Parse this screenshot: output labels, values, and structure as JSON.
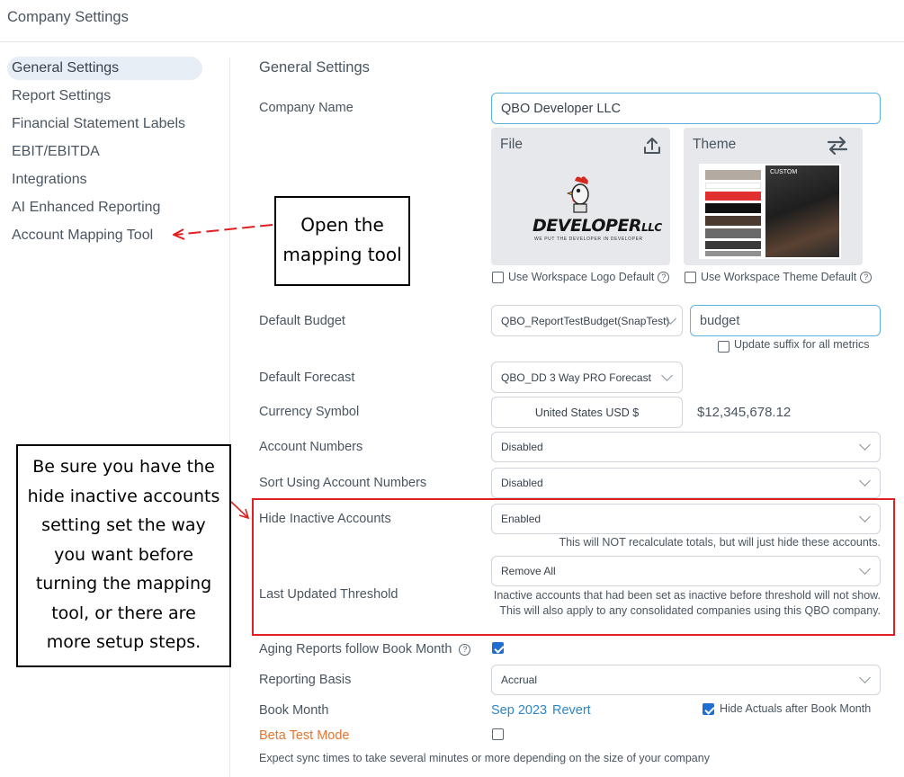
{
  "page_title": "Company Settings",
  "sidebar": {
    "items": [
      {
        "label": "General Settings",
        "active": true
      },
      {
        "label": "Report Settings"
      },
      {
        "label": "Financial Statement Labels"
      },
      {
        "label": "EBIT/EBITDA"
      },
      {
        "label": "Integrations"
      },
      {
        "label": "AI Enhanced Reporting"
      },
      {
        "label": "Account Mapping Tool"
      }
    ]
  },
  "section_title": "General Settings",
  "company_name": {
    "label": "Company Name",
    "value": "QBO Developer LLC"
  },
  "file_card": {
    "title": "File",
    "logo_text": "DEVELOPER",
    "logo_suffix": "LLC",
    "logo_tagline": "WE PUT THE DEVELOPER IN DEVELOPER",
    "checkbox_label": "Use Workspace Logo Default"
  },
  "theme_card": {
    "title": "Theme",
    "badge": "CUSTOM",
    "checkbox_label": "Use Workspace Theme Default",
    "swatches": [
      "#b3aaa2",
      "#ffffff",
      "#e03030",
      "#111111",
      "#4a3a30",
      "#6a6a6a",
      "#3a3a3a",
      "#909090"
    ]
  },
  "default_budget": {
    "label": "Default Budget",
    "value": "QBO_ReportTestBudget(SnapTest)",
    "suffix_value": "budget",
    "suffix_checkbox_label": "Update suffix for all metrics"
  },
  "default_forecast": {
    "label": "Default Forecast",
    "value": "QBO_DD 3 Way PRO Forecast"
  },
  "currency": {
    "label": "Currency Symbol",
    "value": "United States USD $",
    "example": "$12,345,678.12"
  },
  "account_numbers": {
    "label": "Account Numbers",
    "value": "Disabled"
  },
  "sort_account_numbers": {
    "label": "Sort Using Account Numbers",
    "value": "Disabled"
  },
  "hide_inactive": {
    "label": "Hide Inactive Accounts",
    "value": "Enabled",
    "note": "This will NOT recalculate totals, but will just hide these accounts."
  },
  "last_updated": {
    "label": "Last Updated Threshold",
    "value": "Remove All",
    "note": "Inactive accounts that had been set as inactive before threshold will not show. This will also apply to any consolidated companies using this QBO company."
  },
  "aging_reports": {
    "label": "Aging Reports follow Book Month",
    "checked": true
  },
  "reporting_basis": {
    "label": "Reporting Basis",
    "value": "Accrual"
  },
  "book_month": {
    "label": "Book Month",
    "value": "Sep 2023",
    "revert_label": "Revert",
    "hide_actuals_label": "Hide Actuals after Book Month",
    "hide_actuals_checked": true
  },
  "beta_test": {
    "label": "Beta Test Mode",
    "checked": false,
    "note": "Expect sync times to take several minutes or more depending on the size of your company"
  },
  "annotations": {
    "mapping_callout": [
      "Open the",
      "mapping tool"
    ],
    "inactive_callout": [
      "Be sure you have the",
      "hide inactive accounts",
      "setting set the way",
      "you want before",
      "turning the mapping",
      "tool, or there are",
      "more setup steps."
    ]
  },
  "colors": {
    "accent": "#1f6fd1",
    "link": "#2f86c8",
    "highlight_red": "#e02020",
    "beta_orange": "#e8742e"
  },
  "icons": [
    "upload-icon",
    "swap-arrows-icon",
    "help-circle-icon",
    "chevron-down-icon"
  ]
}
